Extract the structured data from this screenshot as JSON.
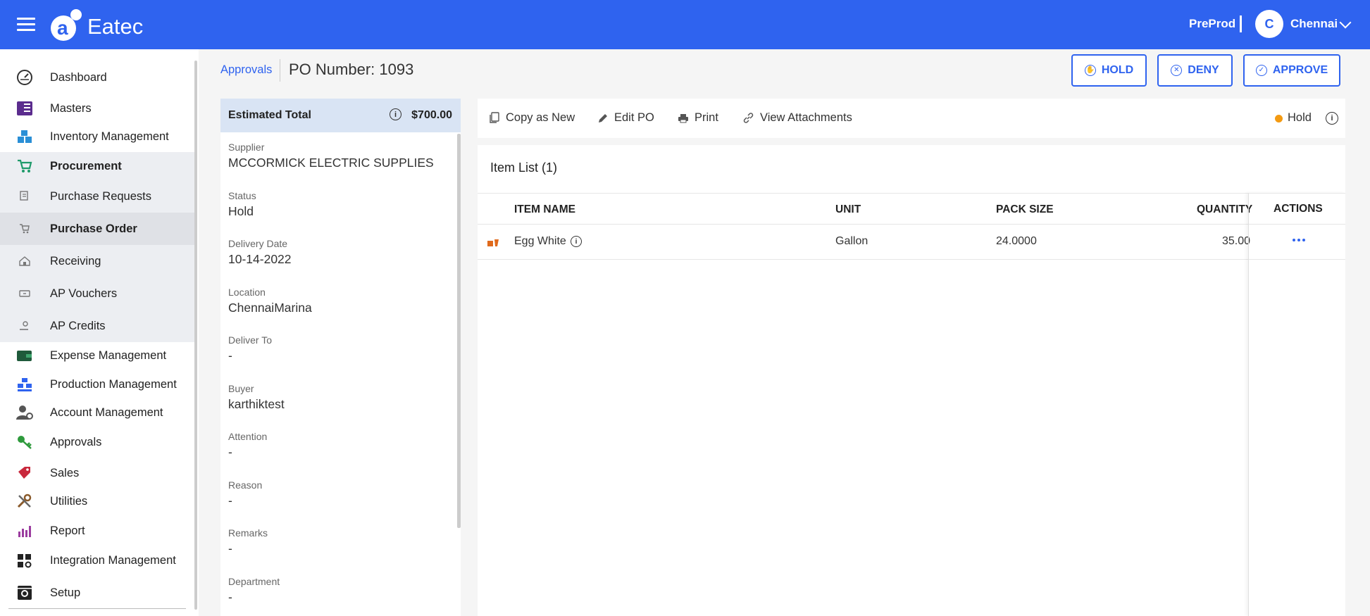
{
  "header": {
    "brand": "Eatec",
    "environment": "PreProd",
    "user_initial": "C",
    "user_name": "Chennai"
  },
  "sidebar": {
    "items": [
      {
        "label": "Dashboard",
        "icon": "dashboard-icon"
      },
      {
        "label": "Masters",
        "icon": "masters-icon"
      },
      {
        "label": "Inventory Management",
        "icon": "inventory-icon"
      },
      {
        "label": "Procurement",
        "icon": "procurement-icon"
      },
      {
        "label": "Purchase Requests",
        "icon": "purchase-requests-icon"
      },
      {
        "label": "Purchase Order",
        "icon": "purchase-order-icon"
      },
      {
        "label": "Receiving",
        "icon": "receiving-icon"
      },
      {
        "label": "AP Vouchers",
        "icon": "ap-vouchers-icon"
      },
      {
        "label": "AP Credits",
        "icon": "ap-credits-icon"
      },
      {
        "label": "Expense Management",
        "icon": "expense-icon"
      },
      {
        "label": "Production Management",
        "icon": "production-icon"
      },
      {
        "label": "Account Management",
        "icon": "account-icon"
      },
      {
        "label": "Approvals",
        "icon": "approvals-key-icon"
      },
      {
        "label": "Sales",
        "icon": "sales-tag-icon"
      },
      {
        "label": "Utilities",
        "icon": "utilities-tools-icon"
      },
      {
        "label": "Report",
        "icon": "report-chart-icon"
      },
      {
        "label": "Integration Management",
        "icon": "integration-icon"
      },
      {
        "label": "Setup",
        "icon": "setup-icon"
      }
    ]
  },
  "page": {
    "breadcrumb": "Approvals",
    "title": "PO Number: 1093",
    "buttons": {
      "hold": "HOLD",
      "deny": "DENY",
      "approve": "APPROVE"
    }
  },
  "summary": {
    "total_label": "Estimated Total",
    "total_value": "$700.00",
    "fields": [
      {
        "label": "Supplier",
        "value": "MCCORMICK ELECTRIC SUPPLIES"
      },
      {
        "label": "Status",
        "value": "Hold"
      },
      {
        "label": "Delivery Date",
        "value": "10-14-2022"
      },
      {
        "label": "Location",
        "value": "ChennaiMarina"
      },
      {
        "label": "Deliver To",
        "value": "-"
      },
      {
        "label": "Buyer",
        "value": "karthiktest"
      },
      {
        "label": "Attention",
        "value": "-"
      },
      {
        "label": "Reason",
        "value": "-"
      },
      {
        "label": "Remarks",
        "value": "-"
      },
      {
        "label": "Department",
        "value": "-"
      }
    ]
  },
  "toolbar": {
    "copy": "Copy as New",
    "edit": "Edit PO",
    "print": "Print",
    "attachments": "View Attachments",
    "status": "Hold",
    "status_color": "#f39a12"
  },
  "items": {
    "title": "Item List (1)",
    "columns": [
      "ITEM NAME",
      "UNIT",
      "PACK SIZE",
      "QUANTITY",
      "ACTIONS"
    ],
    "rows": [
      {
        "name": "Egg White",
        "unit": "Gallon",
        "pack_size": "24.0000",
        "quantity": "35.00"
      }
    ]
  },
  "colors": {
    "brand": "#2f63ef"
  }
}
